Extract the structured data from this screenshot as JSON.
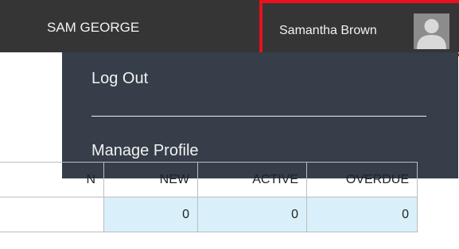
{
  "header": {
    "brand": "SAM GEORGE",
    "user_name": "Samantha Brown",
    "avatar_icon": "user-silhouette-icon",
    "highlight_color": "#e8111c"
  },
  "user_dropdown": {
    "items": [
      {
        "label": "Log Out"
      },
      {
        "label": "Manage Profile"
      }
    ]
  },
  "table": {
    "columns": [
      "N",
      "NEW",
      "ACTIVE",
      "OVERDUE"
    ],
    "row": [
      "",
      "0",
      "0",
      "0"
    ]
  }
}
